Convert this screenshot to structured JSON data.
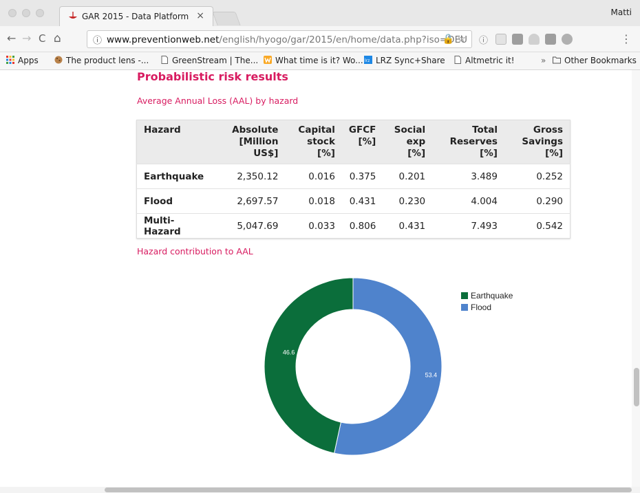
{
  "browser": {
    "tab_title": "GAR 2015 - Data Platform",
    "tab_close": "×",
    "profile_name": "Matti",
    "url_info_icon": "ⓘ",
    "url_host": "www.preventionweb.net",
    "url_path": "/english/hyogo/gar/2015/en/home/data.php?iso=DEU",
    "nav": {
      "back": "←",
      "forward": "→",
      "reload": "C",
      "home": "⌂"
    },
    "bookmarks": [
      {
        "label": "Apps",
        "icon": "apps-grid-icon"
      },
      {
        "label": "The product lens -...",
        "icon": "cookie-icon"
      },
      {
        "label": "GreenStream | The...",
        "icon": "page-icon"
      },
      {
        "label": "What time is it? Wo...",
        "icon": "w-logo-icon"
      },
      {
        "label": "LRZ Sync+Share",
        "icon": "lrz-logo-icon"
      },
      {
        "label": "Altmetric it!",
        "icon": "page-icon"
      }
    ],
    "bookmarks_overflow": "»",
    "other_bookmarks": "Other Bookmarks"
  },
  "page": {
    "section_title": "Probabilistic risk results",
    "table_title": "Average Annual Loss (AAL) by hazard",
    "table": {
      "headers": [
        [
          "Hazard",
          ""
        ],
        [
          "Absolute",
          "[Million US$]"
        ],
        [
          "Capital",
          "stock [%]"
        ],
        [
          "GFCF",
          "[%]"
        ],
        [
          "Social",
          "exp [%]"
        ],
        [
          "Total",
          "Reserves [%]"
        ],
        [
          "Gross",
          "Savings [%]"
        ]
      ],
      "rows": [
        [
          "Earthquake",
          "2,350.12",
          "0.016",
          "0.375",
          "0.201",
          "3.489",
          "0.252"
        ],
        [
          "Flood",
          "2,697.57",
          "0.018",
          "0.431",
          "0.230",
          "4.004",
          "0.290"
        ],
        [
          "Multi-Hazard",
          "5,047.69",
          "0.033",
          "0.806",
          "0.431",
          "7.493",
          "0.542"
        ]
      ]
    },
    "chart_title": "Hazard contribution to AAL"
  },
  "chart_data": {
    "type": "pie",
    "donut": true,
    "title": "Hazard contribution to AAL",
    "categories": [
      "Earthquake",
      "Flood"
    ],
    "values": [
      46.6,
      53.4
    ],
    "labels": [
      "46.6",
      "53.4"
    ],
    "colors": [
      "#0b6e3b",
      "#4f83cc"
    ],
    "legend_position": "right"
  },
  "colors": {
    "accent": "#d81b60",
    "earthquake": "#0b6e3b",
    "flood": "#4f83cc"
  }
}
